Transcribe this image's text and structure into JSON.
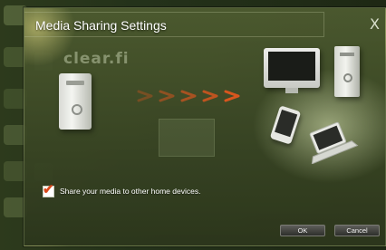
{
  "dialog": {
    "title": "Media Sharing Settings",
    "close_glyph": "X",
    "brand_logo_text": "clear.fi"
  },
  "share": {
    "checked": true,
    "label": "Share your media to other home devices."
  },
  "buttons": {
    "ok_label": "OK",
    "cancel_label": "Cancel"
  },
  "colors": {
    "accent_orange": "#d8481b",
    "arrow_orange": "#e0561e",
    "dialog_green": "#4e5c30"
  },
  "icons": [
    "pc-tower-icon",
    "arrow-icon",
    "monitor-icon",
    "phone-icon",
    "laptop-icon",
    "checkmark-icon",
    "close-icon"
  ]
}
